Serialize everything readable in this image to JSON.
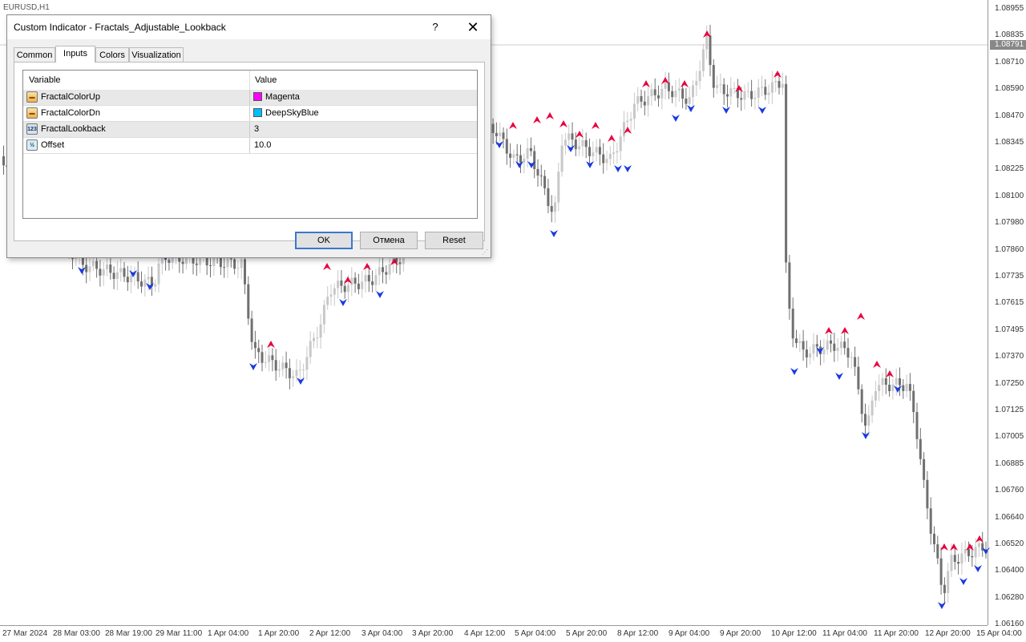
{
  "chart": {
    "symbol": "EURUSD,H1",
    "price_labels": [
      "1.08955",
      "1.08835",
      "1.08710",
      "1.08590",
      "1.08470",
      "1.08345",
      "1.08225",
      "1.08100",
      "1.07980",
      "1.07860",
      "1.07735",
      "1.07615",
      "1.07495",
      "1.07370",
      "1.07250",
      "1.07125",
      "1.07005",
      "1.06885",
      "1.06760",
      "1.06640",
      "1.06520",
      "1.06400",
      "1.06280",
      "1.06160"
    ],
    "current_price": "1.08791",
    "time_labels": [
      "27 Mar 2024",
      "28 Mar 03:00",
      "28 Mar 19:00",
      "29 Mar 11:00",
      "1 Apr 04:00",
      "1 Apr 20:00",
      "2 Apr 12:00",
      "3 Apr 04:00",
      "3 Apr 20:00",
      "4 Apr 12:00",
      "5 Apr 04:00",
      "5 Apr 20:00",
      "8 Apr 12:00",
      "9 Apr 04:00",
      "9 Apr 20:00",
      "10 Apr 12:00",
      "11 Apr 04:00",
      "11 Apr 20:00",
      "12 Apr 20:00",
      "15 Apr 04:00"
    ],
    "colors": {
      "up_fractal": "#e8003d",
      "down_fractal": "#1a3ae0",
      "bull_candle": "#c8c8c8",
      "bear_candle": "#707070",
      "grid_line": "#cccccc"
    }
  },
  "dialog": {
    "title": "Custom Indicator - Fractals_Adjustable_Lookback",
    "help_label": "?",
    "close_label": "✕",
    "tabs": [
      {
        "label": "Common"
      },
      {
        "label": "Inputs"
      },
      {
        "label": "Colors"
      },
      {
        "label": "Visualization"
      }
    ],
    "active_tab": "Inputs",
    "table": {
      "col_variable": "Variable",
      "col_value": "Value",
      "rows": [
        {
          "icon": "color-param-icon",
          "icon_text": "▬",
          "name": "FractalColorUp",
          "value": "Magenta",
          "swatch": "#ff00ff"
        },
        {
          "icon": "color-param-icon",
          "icon_text": "▬",
          "name": "FractalColorDn",
          "value": "DeepSkyBlue",
          "swatch": "#00bfff"
        },
        {
          "icon": "integer-param-icon",
          "icon_text": "123",
          "name": "FractalLookback",
          "value": "3"
        },
        {
          "icon": "double-param-icon",
          "icon_text": "½",
          "name": "Offset",
          "value": "10.0"
        }
      ]
    },
    "buttons": {
      "ok": "OK",
      "cancel": "Отмена",
      "reset": "Reset"
    }
  }
}
